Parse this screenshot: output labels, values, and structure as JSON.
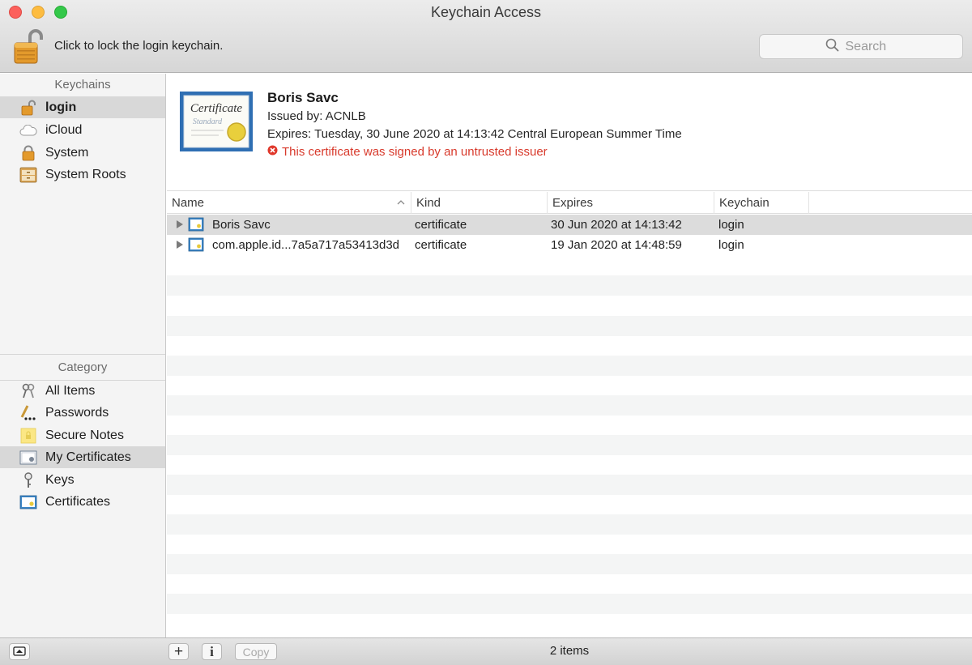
{
  "window": {
    "title": "Keychain Access"
  },
  "toolbar": {
    "lock_label": "Click to lock the login keychain.",
    "search_placeholder": "Search"
  },
  "sidebar": {
    "keychains_header": "Keychains",
    "keychains": [
      {
        "label": "login",
        "icon": "unlocked-padlock-icon",
        "selected": true
      },
      {
        "label": "iCloud",
        "icon": "cloud-icon"
      },
      {
        "label": "System",
        "icon": "padlock-icon"
      },
      {
        "label": "System Roots",
        "icon": "cabinet-icon"
      }
    ],
    "category_header": "Category",
    "categories": [
      {
        "label": "All Items",
        "icon": "keys-icon"
      },
      {
        "label": "Passwords",
        "icon": "password-pen-icon"
      },
      {
        "label": "Secure Notes",
        "icon": "note-icon"
      },
      {
        "label": "My Certificates",
        "icon": "my-certificate-icon",
        "selected": true
      },
      {
        "label": "Keys",
        "icon": "key-icon"
      },
      {
        "label": "Certificates",
        "icon": "certificate-icon"
      }
    ]
  },
  "detail": {
    "badge_line1": "Certificate",
    "badge_line2": "Standard",
    "name": "Boris Savc",
    "issued_by": "Issued by: ACNLB",
    "expires": "Expires: Tuesday, 30 June 2020 at 14:13:42 Central European Summer Time",
    "warning": "This certificate was signed by an untrusted issuer"
  },
  "table": {
    "columns": [
      "Name",
      "Kind",
      "Expires",
      "Keychain"
    ],
    "rows": [
      {
        "name": "Boris Savc",
        "kind": "certificate",
        "expires": "30 Jun 2020 at 14:13:42",
        "keychain": "login",
        "selected": true
      },
      {
        "name": "com.apple.id...7a5a717a53413d3d",
        "kind": "certificate",
        "expires": "19 Jan 2020 at 14:48:59",
        "keychain": "login"
      }
    ]
  },
  "bottombar": {
    "add_label": "+",
    "info_label": "i",
    "copy_label": "Copy",
    "status": "2 items"
  },
  "colors": {
    "selection": "#dcdcdc",
    "warning": "#d83a2c",
    "traffic_red": "#fc605c",
    "traffic_yellow": "#fdbc40",
    "traffic_green": "#34c84a"
  }
}
